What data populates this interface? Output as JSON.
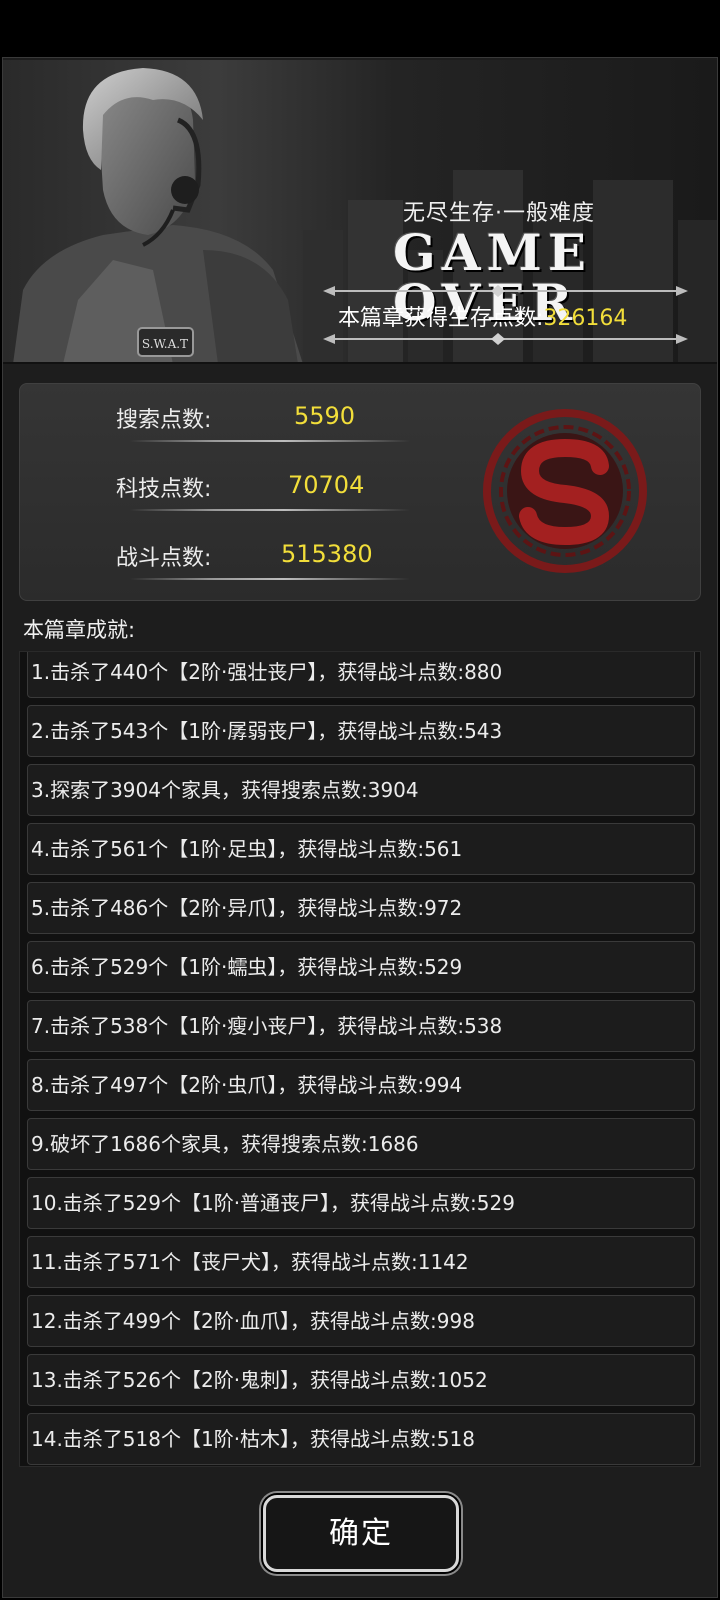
{
  "header": {
    "mode_title": "无尽生存·一般难度",
    "gameover_line1": "GAME",
    "gameover_line2": "OVER",
    "points_label": "本篇章获得生存点数:",
    "points_value": "326164",
    "badge_text": "S.W.A.T"
  },
  "stats": [
    {
      "label": "搜索点数:",
      "value": "5590"
    },
    {
      "label": "科技点数:",
      "value": "70704"
    },
    {
      "label": "战斗点数:",
      "value": "515380"
    }
  ],
  "achievements_title": "本篇章成就:",
  "achievements": [
    "1.击杀了440个【2阶·强壮丧尸】，获得战斗点数:880",
    "2.击杀了543个【1阶·孱弱丧尸】，获得战斗点数:543",
    "3.探索了3904个家具，获得搜索点数:3904",
    "4.击杀了561个【1阶·足虫】，获得战斗点数:561",
    "5.击杀了486个【2阶·异爪】，获得战斗点数:972",
    "6.击杀了529个【1阶·蠕虫】，获得战斗点数:529",
    "7.击杀了538个【1阶·瘦小丧尸】，获得战斗点数:538",
    "8.击杀了497个【2阶·虫爪】，获得战斗点数:994",
    "9.破坏了1686个家具，获得搜索点数:1686",
    "10.击杀了529个【1阶·普通丧尸】，获得战斗点数:529",
    "11.击杀了571个【丧尸犬】，获得战斗点数:1142",
    "12.击杀了499个【2阶·血爪】，获得战斗点数:998",
    "13.击杀了526个【2阶·鬼刺】，获得战斗点数:1052",
    "14.击杀了518个【1阶·枯木】，获得战斗点数:518"
  ],
  "confirm_label": "确定",
  "colors": {
    "accent_yellow": "#f2de3a",
    "emblem_red": "#8b1d1d"
  },
  "icons": {
    "emblem": "s-emblem-icon"
  }
}
